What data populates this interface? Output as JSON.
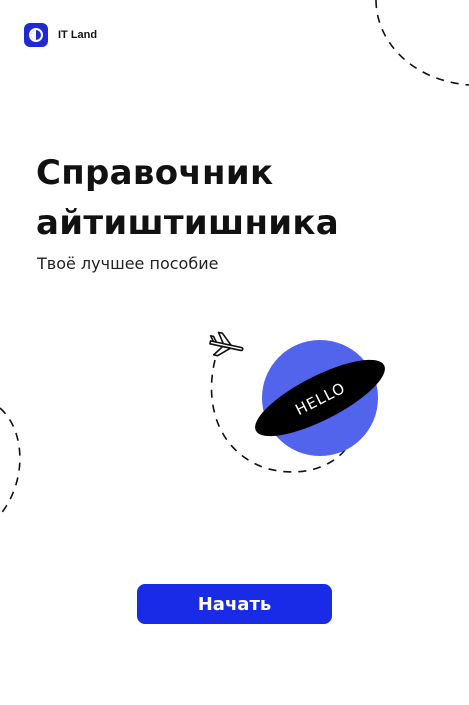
{
  "app": {
    "brand_name": "IT Land"
  },
  "hero": {
    "title_line1": "Справочник",
    "title_line2": "айтиштишника",
    "subtitle": "Твоё лучшее пособие"
  },
  "illustration": {
    "planet_label": "HELLO",
    "icons": [
      "airplane-icon",
      "planet-icon"
    ]
  },
  "actions": {
    "start_label": "Начать"
  },
  "colors": {
    "primary": "#1a2be8",
    "planet": "#5263ec",
    "ring": "#000000",
    "background": "#ffffff"
  }
}
